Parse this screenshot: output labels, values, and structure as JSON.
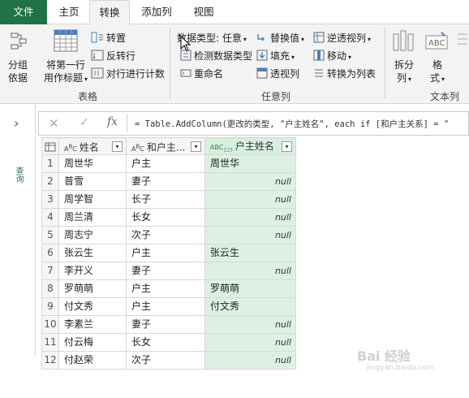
{
  "tabs": [
    {
      "label": "文件"
    },
    {
      "label": "主页"
    },
    {
      "label": "转换"
    },
    {
      "label": "添加列"
    },
    {
      "label": "视图"
    }
  ],
  "ribbon": {
    "group_label_tool": "分组\n依据",
    "group_by_line1": "分组",
    "group_by_line2": "依据",
    "use_first_row_line1": "将第一行",
    "use_first_row_line2": "用作标题",
    "transpose": "转置",
    "reverse_rows": "反转行",
    "count_rows": "对行进行计数",
    "table_group": "表格",
    "data_type": "数据类型: 任意",
    "detect_type": "检测数据类型",
    "rename": "重命名",
    "replace_values": "替换值",
    "fill": "填充",
    "pivot": "透视列",
    "unpivot": "逆透视列",
    "move": "移动",
    "to_list": "转换为列表",
    "any_column_group": "任意列",
    "split_line1": "拆分",
    "split_line2": "列",
    "format_line1": "格",
    "format_line2": "式",
    "text_column_group": "文本列"
  },
  "formula_bar": {
    "cancel": "✕",
    "confirm": "✓",
    "fx": "fx",
    "formula": "= Table.AddColumn(更改的类型, \"户主姓名\", each if [和户主关系] = \""
  },
  "side": {
    "queries_label": "查询"
  },
  "table": {
    "headers": {
      "col1": "姓名",
      "col2": "和户主...",
      "col3": "户主姓名"
    },
    "rows": [
      {
        "n": "1",
        "name": "周世华",
        "rel": "户主",
        "head": "周世华"
      },
      {
        "n": "2",
        "name": "普雪",
        "rel": "妻子",
        "head": "null"
      },
      {
        "n": "3",
        "name": "周学智",
        "rel": "长子",
        "head": "null"
      },
      {
        "n": "4",
        "name": "周兰清",
        "rel": "长女",
        "head": "null"
      },
      {
        "n": "5",
        "name": "周志宁",
        "rel": "次子",
        "head": "null"
      },
      {
        "n": "6",
        "name": "张云生",
        "rel": "户主",
        "head": "张云生"
      },
      {
        "n": "7",
        "name": "李开义",
        "rel": "妻子",
        "head": "null"
      },
      {
        "n": "8",
        "name": "罗萌萌",
        "rel": "户主",
        "head": "罗萌萌"
      },
      {
        "n": "9",
        "name": "付文秀",
        "rel": "户主",
        "head": "付文秀"
      },
      {
        "n": "10",
        "name": "李素兰",
        "rel": "妻子",
        "head": "null"
      },
      {
        "n": "11",
        "name": "付云梅",
        "rel": "长女",
        "head": "null"
      },
      {
        "n": "12",
        "name": "付赵荣",
        "rel": "次子",
        "head": "null"
      }
    ]
  },
  "watermark": {
    "brand": "Bai 经验",
    "url": "jingyan.baidu.com"
  },
  "colors": {
    "file_tab": "#217346",
    "custom_column_bg": "#dcf1e3",
    "ribbon_bg": "#f3f3f3"
  }
}
